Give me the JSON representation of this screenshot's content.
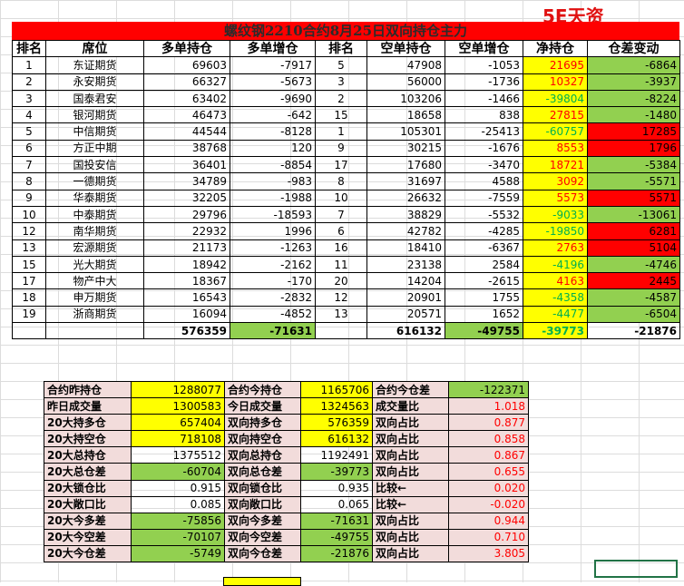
{
  "watermark": "5E天资5etz.com",
  "title": "螺纹钢2210合约8月25日双向持仓主力",
  "headers": [
    "排名",
    "席位",
    "多单持仓",
    "多单增仓",
    "排名",
    "空单持仓",
    "空单增仓",
    "净持仓",
    "仓差变动"
  ],
  "rows": [
    {
      "rank": "1",
      "seat": "东证期货",
      "long": "69603",
      "long_chg": "-7917",
      "srank": "5",
      "short": "47908",
      "short_chg": "-1053",
      "net": "21695",
      "diff": "-6864"
    },
    {
      "rank": "2",
      "seat": "永安期货",
      "long": "66327",
      "long_chg": "-5673",
      "srank": "3",
      "short": "56000",
      "short_chg": "-1736",
      "net": "10327",
      "diff": "-3937"
    },
    {
      "rank": "3",
      "seat": "国泰君安",
      "long": "63402",
      "long_chg": "-9690",
      "srank": "2",
      "short": "103206",
      "short_chg": "-1466",
      "net": "-39804",
      "diff": "-8224"
    },
    {
      "rank": "4",
      "seat": "银河期货",
      "long": "46473",
      "long_chg": "-642",
      "srank": "15",
      "short": "18658",
      "short_chg": "838",
      "net": "27815",
      "diff": "-1480"
    },
    {
      "rank": "5",
      "seat": "中信期货",
      "long": "44544",
      "long_chg": "-8128",
      "srank": "1",
      "short": "105301",
      "short_chg": "-25413",
      "net": "-60757",
      "diff": "17285"
    },
    {
      "rank": "6",
      "seat": "方正中期",
      "long": "38768",
      "long_chg": "120",
      "srank": "9",
      "short": "30215",
      "short_chg": "-1676",
      "net": "8553",
      "diff": "1796"
    },
    {
      "rank": "7",
      "seat": "国投安信",
      "long": "36401",
      "long_chg": "-8854",
      "srank": "17",
      "short": "17680",
      "short_chg": "-3470",
      "net": "18721",
      "diff": "-5384"
    },
    {
      "rank": "8",
      "seat": "一德期货",
      "long": "34789",
      "long_chg": "-983",
      "srank": "8",
      "short": "31697",
      "short_chg": "4588",
      "net": "3092",
      "diff": "-5571"
    },
    {
      "rank": "9",
      "seat": "华泰期货",
      "long": "32205",
      "long_chg": "-1988",
      "srank": "10",
      "short": "26632",
      "short_chg": "-7559",
      "net": "5573",
      "diff": "5571"
    },
    {
      "rank": "10",
      "seat": "中泰期货",
      "long": "29796",
      "long_chg": "-18593",
      "srank": "7",
      "short": "38829",
      "short_chg": "-5532",
      "net": "-9033",
      "diff": "-13061"
    },
    {
      "rank": "12",
      "seat": "南华期货",
      "long": "22932",
      "long_chg": "1996",
      "srank": "6",
      "short": "42782",
      "short_chg": "-4285",
      "net": "-19850",
      "diff": "6281"
    },
    {
      "rank": "13",
      "seat": "宏源期货",
      "long": "21173",
      "long_chg": "-1263",
      "srank": "16",
      "short": "18410",
      "short_chg": "-6367",
      "net": "2763",
      "diff": "5104"
    },
    {
      "rank": "15",
      "seat": "光大期货",
      "long": "18942",
      "long_chg": "-2162",
      "srank": "11",
      "short": "23138",
      "short_chg": "2584",
      "net": "-4196",
      "diff": "-4746"
    },
    {
      "rank": "17",
      "seat": "物产中大",
      "long": "18367",
      "long_chg": "-170",
      "srank": "20",
      "short": "14204",
      "short_chg": "-2615",
      "net": "4163",
      "diff": "2445"
    },
    {
      "rank": "18",
      "seat": "申万期货",
      "long": "16543",
      "long_chg": "-2832",
      "srank": "12",
      "short": "20901",
      "short_chg": "1755",
      "net": "-4358",
      "diff": "-4587"
    },
    {
      "rank": "19",
      "seat": "浙商期货",
      "long": "16094",
      "long_chg": "-4852",
      "srank": "13",
      "short": "20571",
      "short_chg": "1652",
      "net": "-4477",
      "diff": "-6504"
    }
  ],
  "totals": {
    "long": "576359",
    "long_chg": "-71631",
    "short": "616132",
    "short_chg": "-49755",
    "net": "-39773",
    "diff": "-21876"
  },
  "summary": [
    [
      "合约昨持仓",
      "1288077",
      "合约今持仓",
      "1165706",
      "合约今仓差",
      "-122371"
    ],
    [
      "昨日成交量",
      "1300583",
      "今日成交量",
      "1324563",
      "成交量比",
      "1.018"
    ],
    [
      "20大持多仓",
      "657404",
      "双向持多仓",
      "576359",
      "双向占比",
      "0.877"
    ],
    [
      "20大持空仓",
      "718108",
      "双向持空仓",
      "616132",
      "双向占比",
      "0.858"
    ],
    [
      "20大总持仓",
      "1375512",
      "双向总持仓",
      "1192491",
      "双向占比",
      "0.867"
    ],
    [
      "20大总仓差",
      "-60704",
      "双向总仓差",
      "-39773",
      "双向占比",
      "0.655"
    ],
    [
      "20大锁仓比",
      "0.915",
      "双向锁仓比",
      "0.935",
      "比较←",
      "0.020"
    ],
    [
      "20大敞口比",
      "0.085",
      "双向敞口比",
      "0.065",
      "比较←",
      "-0.020"
    ],
    [
      "20大今多差",
      "-75856",
      "双向今多差",
      "-71631",
      "双向占比",
      "0.944"
    ],
    [
      "20大今空差",
      "-70107",
      "双向今空差",
      "-49755",
      "双向占比",
      "0.710"
    ],
    [
      "20大今仓差",
      "-5749",
      "双向今仓差",
      "-21876",
      "双向占比",
      "3.805"
    ]
  ],
  "colors": {
    "yellow": "#ffff00",
    "green": "#92d050",
    "red": "#ff0000",
    "pink": "#f2dcdb"
  }
}
